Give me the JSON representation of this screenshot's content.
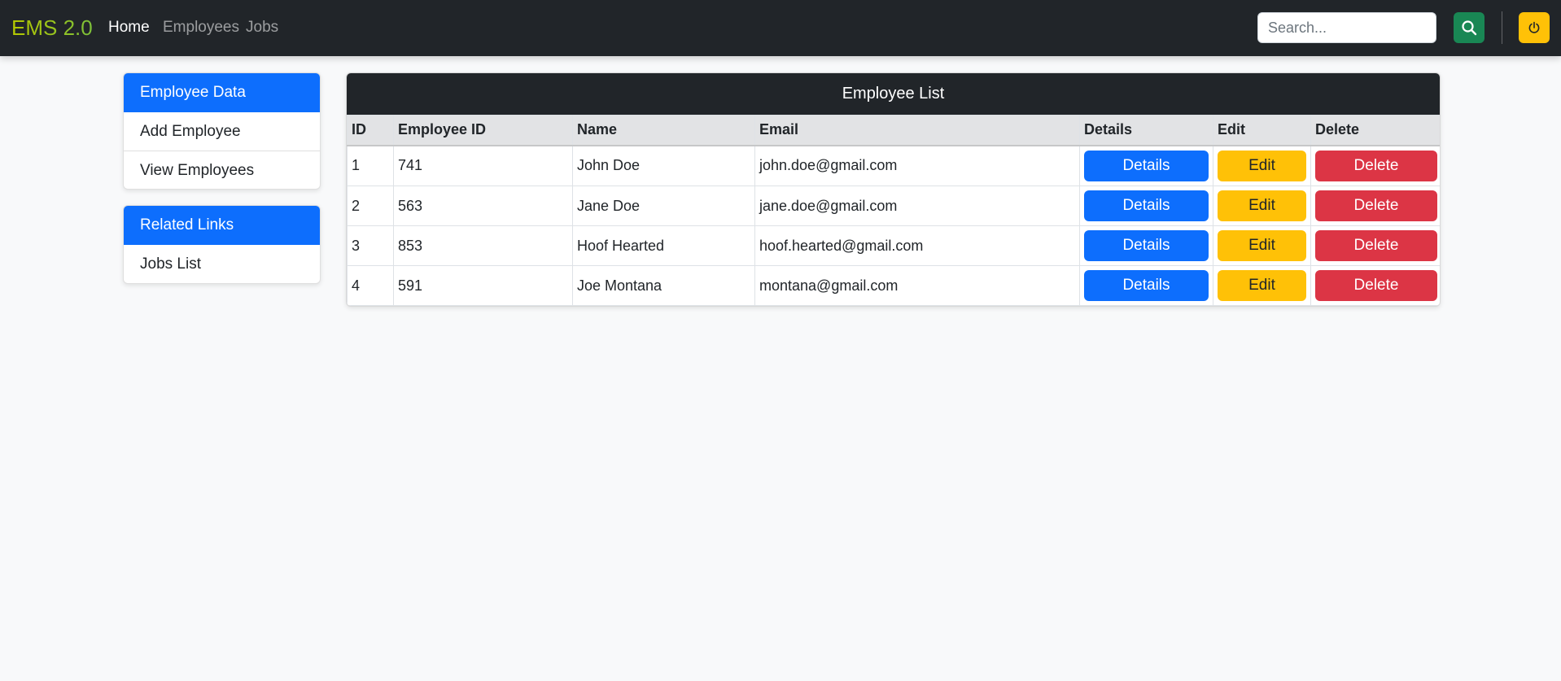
{
  "navbar": {
    "brand": "EMS 2.0",
    "links": [
      "Home",
      "Employees",
      "Jobs"
    ],
    "search_placeholder": "Search...",
    "search_icon": "search-icon",
    "power_icon": "power-icon"
  },
  "sidebar": {
    "employee_card": {
      "title": "Employee Data",
      "items": [
        "Add Employee",
        "View Employees"
      ]
    },
    "links_card": {
      "title": "Related Links",
      "items": [
        "Jobs List"
      ]
    }
  },
  "employee_list": {
    "title": "Employee List",
    "columns": [
      "ID",
      "Employee ID",
      "Name",
      "Email",
      "Details",
      "Edit",
      "Delete"
    ],
    "rows": [
      {
        "id": "1",
        "employee_id": "741",
        "name": "John Doe",
        "email": "john.doe@gmail.com"
      },
      {
        "id": "2",
        "employee_id": "563",
        "name": "Jane Doe",
        "email": "jane.doe@gmail.com"
      },
      {
        "id": "3",
        "employee_id": "853",
        "name": "Hoof Hearted",
        "email": "hoof.hearted@gmail.com"
      },
      {
        "id": "4",
        "employee_id": "591",
        "name": "Joe Montana",
        "email": "montana@gmail.com"
      }
    ],
    "details_label": "Details",
    "edit_label": "Edit",
    "delete_label": "Delete"
  },
  "colors": {
    "navbar": "#212529",
    "primary": "#0d6efd",
    "success": "#198754",
    "warning": "#ffc107",
    "danger": "#dc3545",
    "table_header": "#e2e3e5"
  }
}
